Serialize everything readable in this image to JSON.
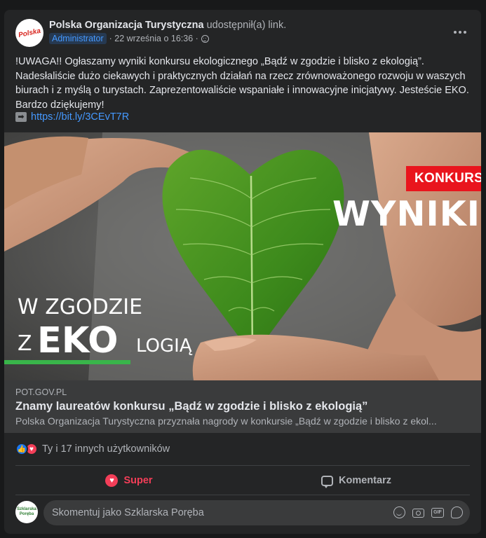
{
  "post": {
    "author": "Polska Organizacja Turystyczna",
    "action": "udostępnił(a) link.",
    "avatar_text": "Polska",
    "role_badge": "Administrator",
    "meta": "· 22 września o 16:36 ·",
    "body": "!UWAGA!! Ogłaszamy wyniki konkursu ekologicznego „Bądź w zgodzie i blisko z ekologią”. Nadesłaliście dużo ciekawych i praktycznych działań na rzecz zrównoważonego rozwoju w waszych biurach i z myślą o turystach. Zaprezentowaliście wspaniałe i innowacyjne inicjatywy. Jesteście EKO. Bardzo dziękujemy!",
    "link_arrow": "➡",
    "link_text": "https://bit.ly/3CEvT7R"
  },
  "image": {
    "konkurs": "KONKURS",
    "wyniki": "WYNIKI",
    "line1": "W ZGODZIE",
    "line2_z": "Z",
    "line2_eko": "EKO",
    "line2_logia": "LOGIĄ"
  },
  "link_card": {
    "domain": "POT.GOV.PL",
    "title": "Znamy laureatów konkursu „Bądź w zgodzie i blisko z ekologią”",
    "description": "Polska Organizacja Turystyczna przyznała nagrody w konkursie „Bądź w zgodzie i blisko z ekol..."
  },
  "reactions": {
    "text": "Ty i 17 innych użytkowników"
  },
  "actions": {
    "super": "Super",
    "comment": "Komentarz"
  },
  "comment_box": {
    "avatar_text": "Szklarska Poręba",
    "placeholder": "Skomentuj jako Szklarska Poręba"
  },
  "colors": {
    "accent_link": "#4599ff",
    "love_red": "#f33e58",
    "konkurs_red": "#e9151d",
    "eko_green": "#39b54a"
  },
  "icons": [
    "more-icon",
    "globe-icon",
    "arrow-right-icon",
    "like-icon",
    "love-icon",
    "heart-icon",
    "comment-icon",
    "emoji-icon",
    "camera-icon",
    "gif-icon",
    "sticker-icon"
  ]
}
